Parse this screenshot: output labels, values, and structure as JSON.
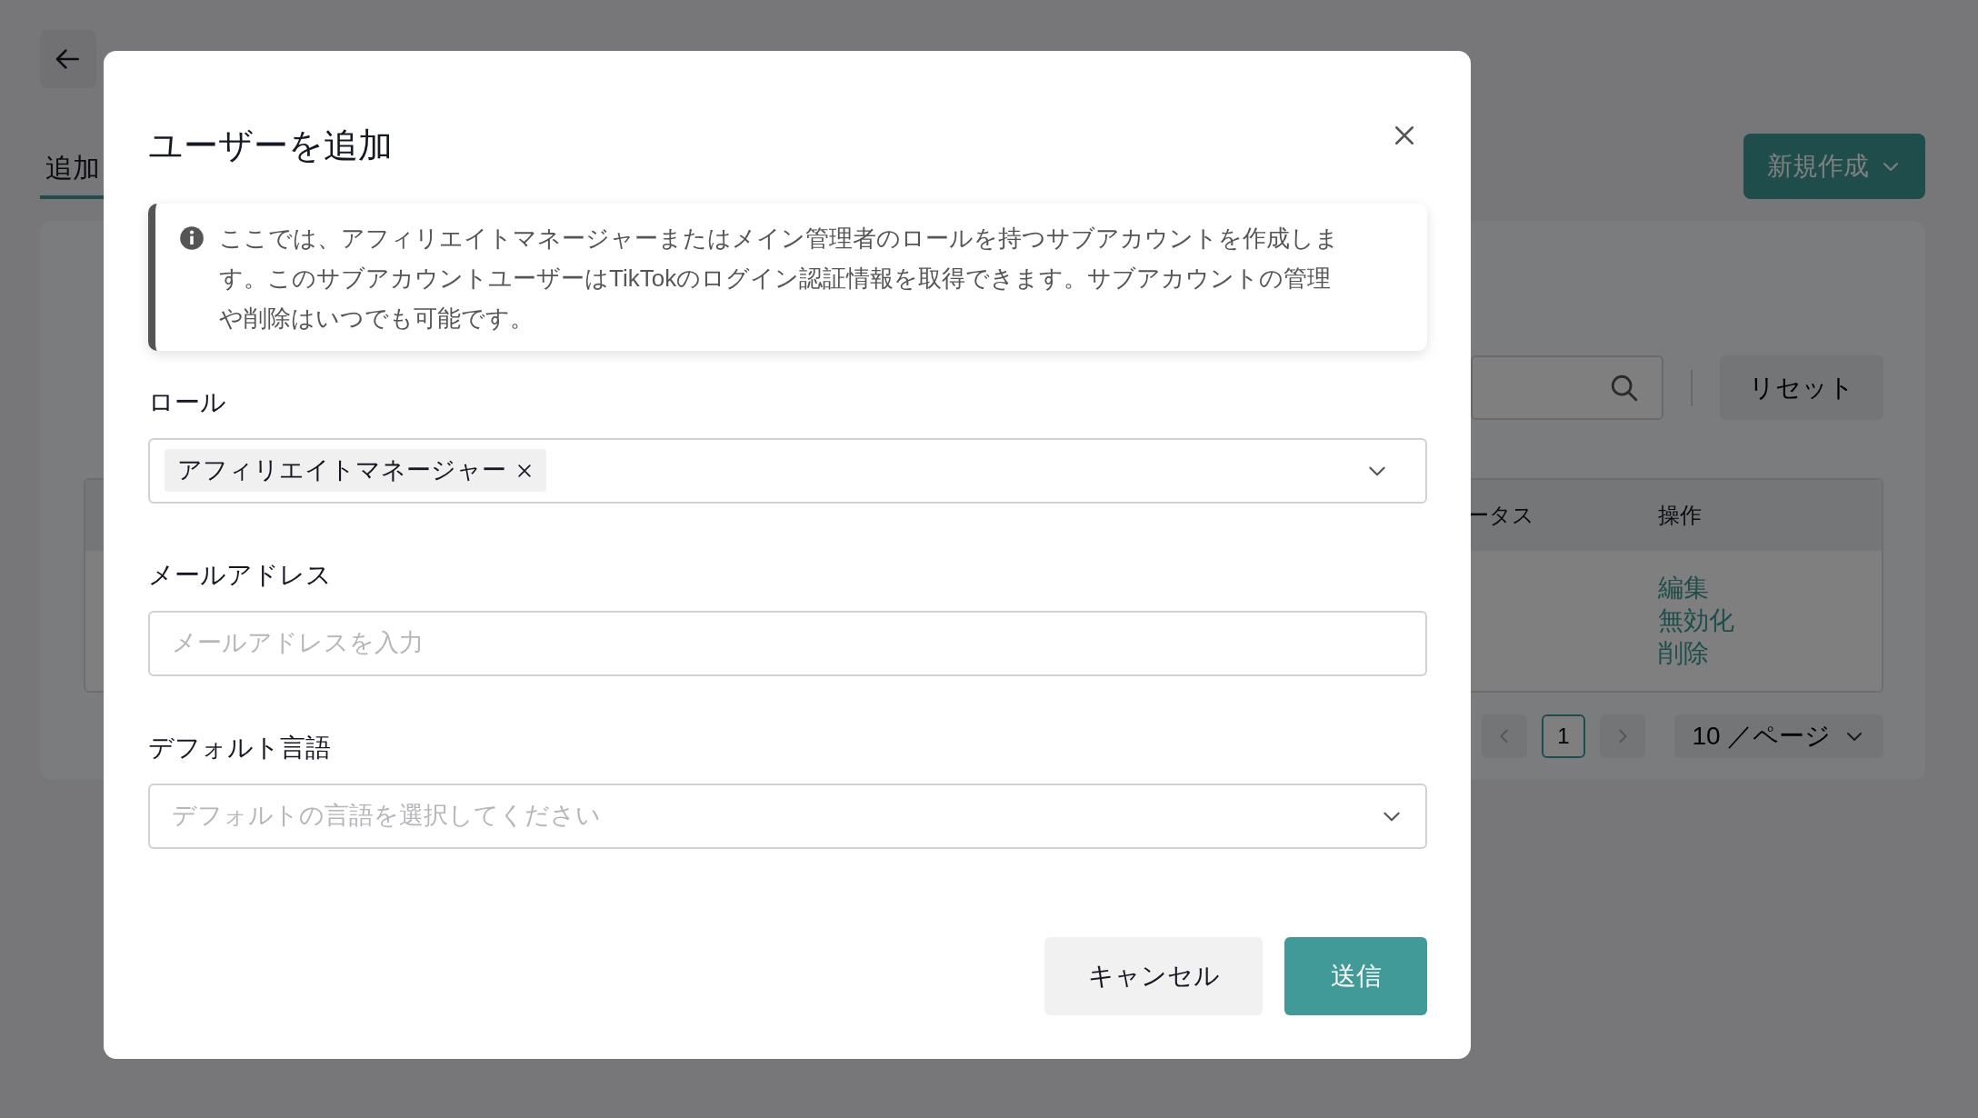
{
  "background": {
    "tabs": [
      {
        "label": "追加",
        "selected": true
      }
    ],
    "new_button": "新規作成",
    "reset_button": "リセット",
    "table": {
      "columns": [
        "ータス",
        "操作"
      ],
      "rows": [
        {
          "actions": [
            "編集",
            "無効化",
            "削除"
          ]
        }
      ]
    },
    "pagination": {
      "pages": [
        {
          "label": "1",
          "selected": true
        }
      ],
      "page_size": "10 ／ページ"
    }
  },
  "modal": {
    "title": "ユーザーを追加",
    "info": "ここでは、アフィリエイトマネージャーまたはメイン管理者のロールを持つサブアカウントを作成します。このサブアカウントユーザーはTikTokのログイン認証情報を取得できます。サブアカウントの管理や削除はいつでも可能です。",
    "fields": [
      {
        "kind": "tags",
        "label": "ロール",
        "tags": [
          "アフィリエイトマネージャー"
        ]
      },
      {
        "kind": "input",
        "label": "メールアドレス",
        "placeholder": "メールアドレスを入力"
      },
      {
        "kind": "select",
        "label": "デフォルト言語",
        "placeholder": "デフォルトの言語を選択してください"
      }
    ],
    "buttons": [
      {
        "label": "キャンセル",
        "kind": "secondary"
      },
      {
        "label": "送信",
        "kind": "primary"
      }
    ]
  }
}
